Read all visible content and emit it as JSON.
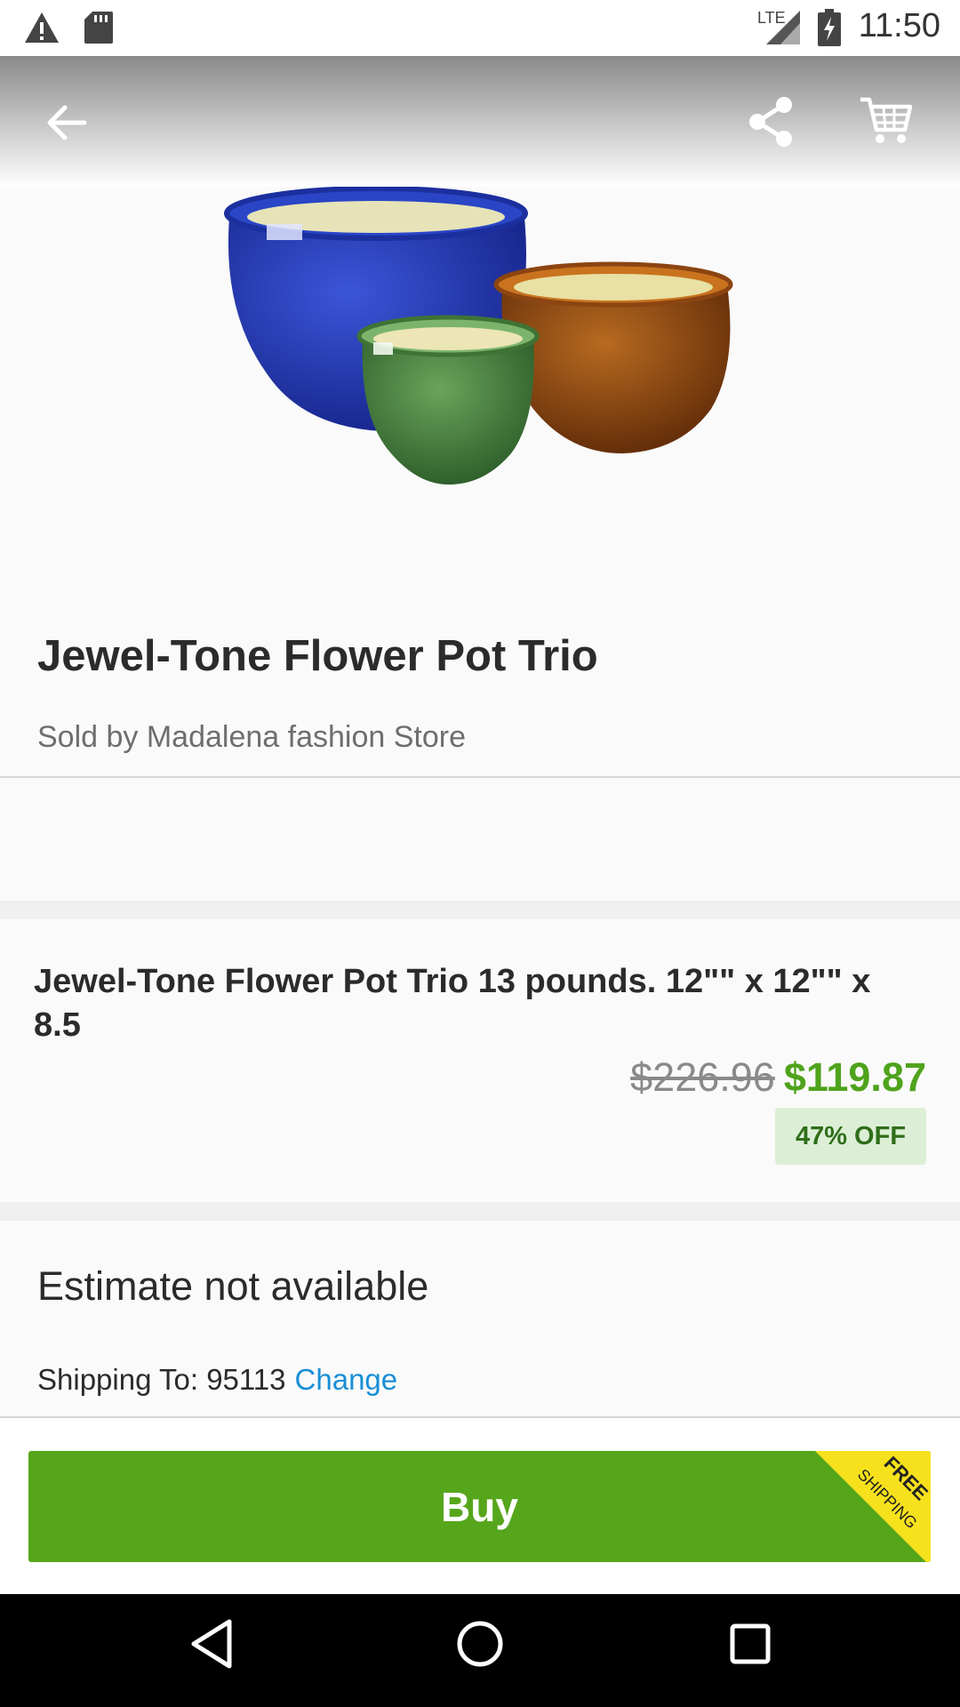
{
  "status_bar": {
    "time": "11:50",
    "network": "LTE"
  },
  "toolbar": {
    "back_icon": "arrow-left-icon",
    "share_icon": "share-icon",
    "cart_icon": "cart-icon"
  },
  "product": {
    "title": "Jewel-Tone Flower Pot Trio",
    "seller": "Sold by Madalena fashion Store",
    "description": "Jewel-Tone Flower Pot Trio 13 pounds. 12\"\" x 12\"\" x 8.5",
    "original_price": "$226.96",
    "price": "$119.87",
    "discount": "47% OFF"
  },
  "shipping": {
    "estimate": "Estimate not available",
    "ship_to": "Shipping To: 95113",
    "change_label": "Change"
  },
  "buy": {
    "label": "Buy",
    "badge_line1": "FREE",
    "badge_line2": "SHIPPING"
  },
  "colors": {
    "accent_green": "#56a61c",
    "price_green": "#4fa31c",
    "link_blue": "#1a8fd6",
    "badge_yellow": "#f7e11c"
  }
}
